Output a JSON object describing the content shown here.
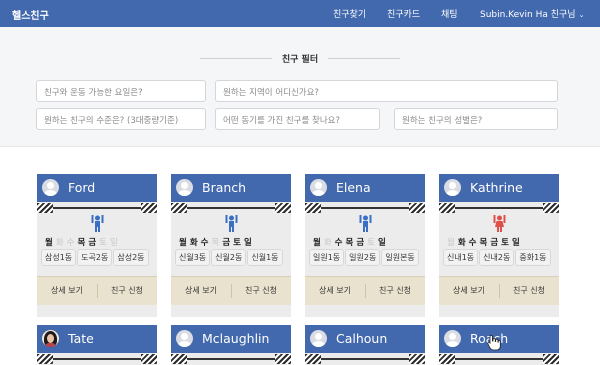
{
  "navbar": {
    "brand": "헬스친구",
    "links": [
      "친구찾기",
      "친구카드",
      "채팅"
    ],
    "user_menu": "Subin.Kevin Ha 친구님",
    "background": "#4268ad"
  },
  "filter": {
    "title": "친구 필터",
    "fields": [
      "친구와 운동 가능한 요일은?",
      "원하는 지역이 어디신가요?",
      "원하는 친구의 수준은? (3대중량기준)",
      "어떤 동기를 가진 친구를 찾나요?",
      "원하는 친구의 성별은?"
    ]
  },
  "cards": [
    {
      "name": "Ford",
      "avatar": "default",
      "lifter_color": "#3a6fc4",
      "days": [
        {
          "d": "월",
          "on": true
        },
        {
          "d": "화",
          "on": false
        },
        {
          "d": "수",
          "on": false
        },
        {
          "d": "목",
          "on": true
        },
        {
          "d": "금",
          "on": true
        },
        {
          "d": "토",
          "on": false
        },
        {
          "d": "일",
          "on": false
        }
      ],
      "locations": [
        "삼성1동",
        "도곡2동",
        "삼성2동"
      ],
      "detail": "상세 보기",
      "apply": "친구 신청"
    },
    {
      "name": "Branch",
      "avatar": "default",
      "lifter_color": "#3a6fc4",
      "days": [
        {
          "d": "월",
          "on": true
        },
        {
          "d": "화",
          "on": true
        },
        {
          "d": "수",
          "on": true
        },
        {
          "d": "목",
          "on": false
        },
        {
          "d": "금",
          "on": true
        },
        {
          "d": "토",
          "on": true
        },
        {
          "d": "일",
          "on": true
        }
      ],
      "locations": [
        "신월3동",
        "신월2동",
        "신월1동"
      ],
      "detail": "상세 보기",
      "apply": "친구 신청"
    },
    {
      "name": "Elena",
      "avatar": "default",
      "lifter_color": "#3a6fc4",
      "days": [
        {
          "d": "월",
          "on": true
        },
        {
          "d": "화",
          "on": false
        },
        {
          "d": "수",
          "on": true
        },
        {
          "d": "목",
          "on": true
        },
        {
          "d": "금",
          "on": true
        },
        {
          "d": "토",
          "on": false
        },
        {
          "d": "일",
          "on": true
        }
      ],
      "locations": [
        "일원1동",
        "일원2동",
        "일원본동"
      ],
      "detail": "상세 보기",
      "apply": "친구 신청"
    },
    {
      "name": "Kathrine",
      "avatar": "default",
      "lifter_color": "#e0504a",
      "days": [
        {
          "d": "월",
          "on": false
        },
        {
          "d": "화",
          "on": true
        },
        {
          "d": "수",
          "on": true
        },
        {
          "d": "목",
          "on": true
        },
        {
          "d": "금",
          "on": true
        },
        {
          "d": "토",
          "on": true
        },
        {
          "d": "일",
          "on": true
        }
      ],
      "locations": [
        "신내1동",
        "신내2동",
        "중화1동"
      ],
      "detail": "상세 보기",
      "apply": "친구 신청"
    },
    {
      "name": "Tate",
      "avatar": "photo"
    },
    {
      "name": "Mclaughlin",
      "avatar": "default"
    },
    {
      "name": "Calhoun",
      "avatar": "default"
    },
    {
      "name": "Roach",
      "avatar": "default"
    }
  ]
}
